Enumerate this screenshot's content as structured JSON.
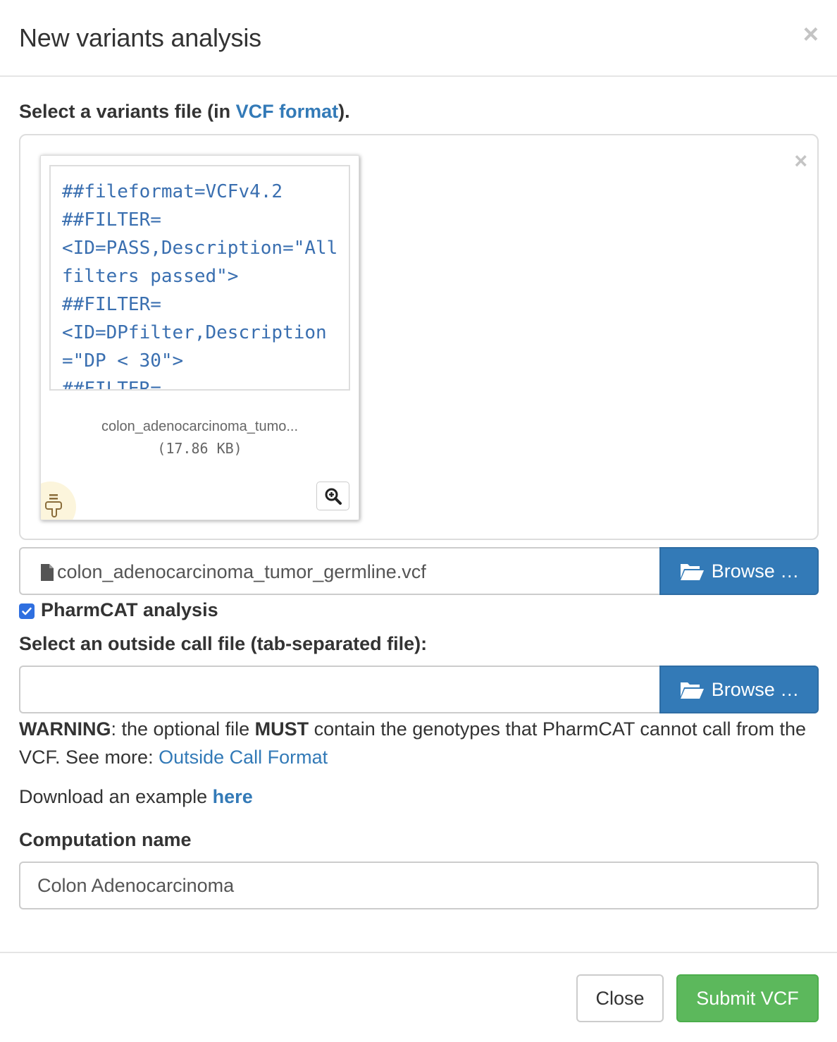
{
  "modal": {
    "title": "New variants analysis",
    "close_glyph": "×"
  },
  "vcf_section": {
    "label_prefix": "Select a variants file (in ",
    "label_link": "VCF format",
    "label_suffix": ")."
  },
  "preview": {
    "remove_glyph": "×",
    "content": "##fileformat=VCFv4.2\n##FILTER=\n<ID=PASS,Description=\"All filters passed\">\n##FILTER=\n<ID=DPfilter,Description=\"DP < 30\">\n##FILTER=",
    "file_name": "colon_adenocarcinoma_tumo...",
    "file_size": "(17.86 KB)",
    "zoom_icon": "zoom-in-icon",
    "drag_icon": "drag-handle-icon"
  },
  "vcf_input": {
    "file_icon": "file-icon",
    "value": "colon_adenocarcinoma_tumor_germline.vcf",
    "browse_icon": "folder-open-icon",
    "browse_label": "Browse …"
  },
  "pharmcat": {
    "checked": true,
    "label": "PharmCAT analysis"
  },
  "outside_call": {
    "label": "Select an outside call file (tab-separated file):",
    "value": "",
    "browse_icon": "folder-open-icon",
    "browse_label": "Browse …"
  },
  "warning": {
    "strong1": "WARNING",
    "text1": ": the optional file ",
    "strong2": "MUST",
    "text2": " contain the genotypes that PharmCAT cannot call from the VCF. See more: ",
    "link": "Outside Call Format"
  },
  "download": {
    "text": "Download an example ",
    "link": "here"
  },
  "computation": {
    "label": "Computation name",
    "value": "Colon Adenocarcinoma"
  },
  "footer": {
    "close_label": "Close",
    "submit_label": "Submit VCF"
  },
  "colors": {
    "primary": "#337ab7",
    "success": "#5cb85c",
    "checkbox": "#2f6fe0",
    "code_text": "#3a6fb0"
  }
}
